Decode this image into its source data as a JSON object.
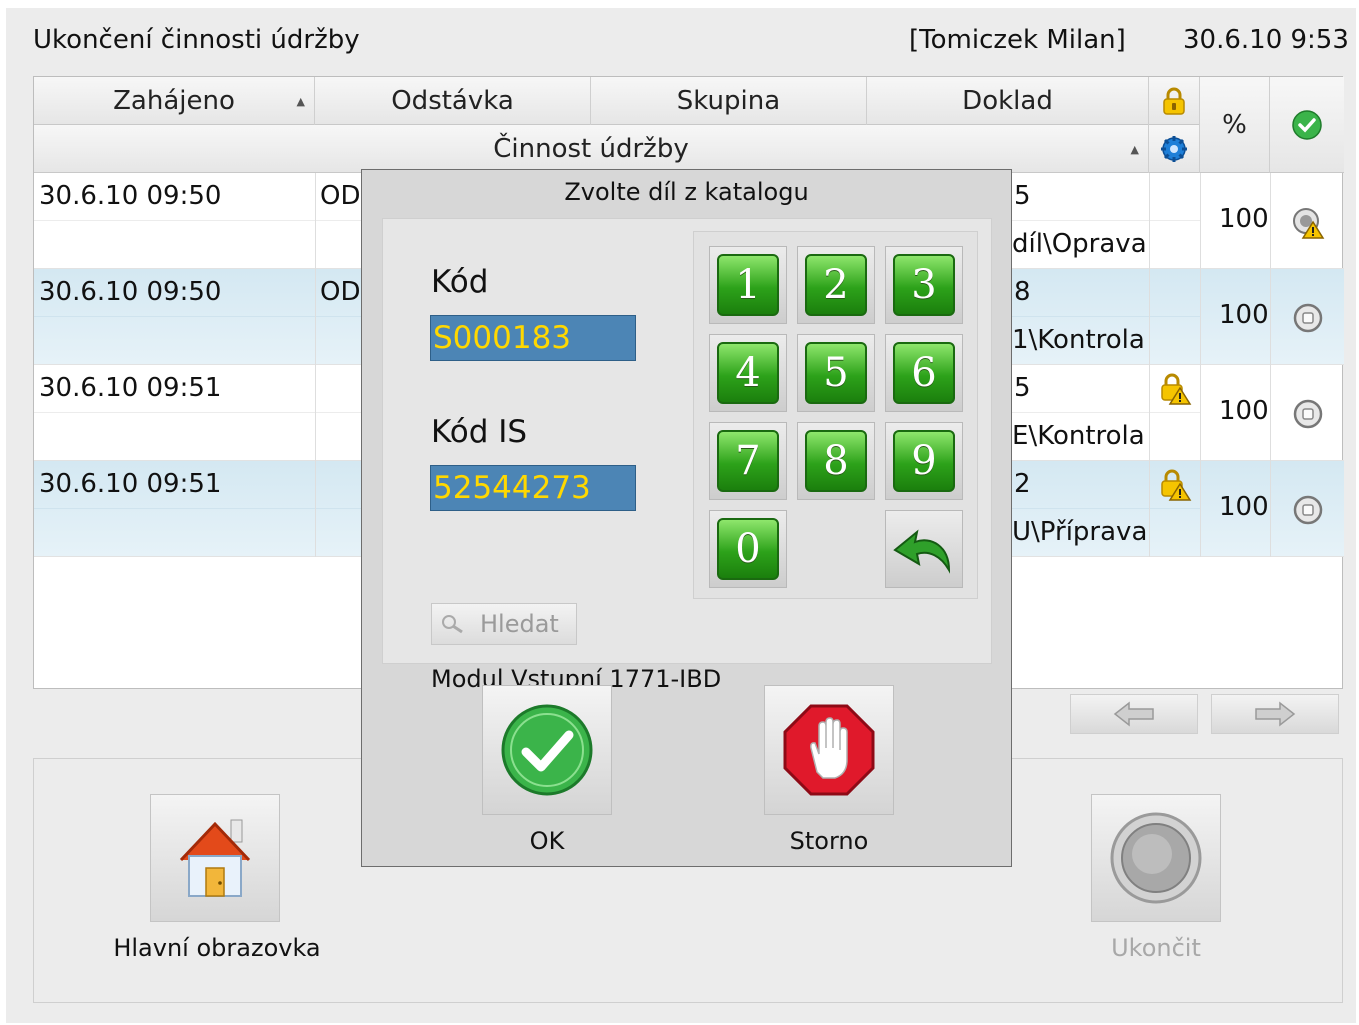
{
  "header": {
    "title": "Ukončení činnosti údržby",
    "user": "[Tomiczek Milan]",
    "datetime": "30.6.10 9:53"
  },
  "grid": {
    "columns": {
      "zahajeno": "Zahájeno",
      "odstavka": "Odstávka",
      "skupina": "Skupina",
      "doklad": "Doklad",
      "percent": "%",
      "cinnost": "Činnost údržby"
    },
    "rows": [
      {
        "date": "30.6.10 09:50",
        "odstavka": "OD",
        "doklad": "5",
        "activity": "díl\\Oprava",
        "percent": "100",
        "status_icon": "warning-status-icon",
        "lock": false
      },
      {
        "date": "30.6.10 09:50",
        "odstavka": "OD",
        "doklad": "8",
        "activity": "1\\Kontrola",
        "percent": "100",
        "status_icon": "stop-status-icon",
        "lock": false
      },
      {
        "date": "30.6.10 09:51",
        "odstavka": "",
        "doklad": "5",
        "activity": "E\\Kontrola",
        "percent": "100",
        "status_icon": "stop-status-icon",
        "lock": true
      },
      {
        "date": "30.6.10 09:51",
        "odstavka": "",
        "doklad": "2",
        "activity": "U\\Příprava",
        "percent": "100",
        "status_icon": "stop-status-icon",
        "lock": true
      }
    ]
  },
  "dialog": {
    "title": "Zvolte díl z katalogu",
    "kod_label": "Kód",
    "kod_value": "S000183",
    "kodis_label": "Kód IS",
    "kodis_value": "52544273",
    "search_label": "Hledat",
    "description": "Modul Vstupní 1771-IBD",
    "keys": [
      "1",
      "2",
      "3",
      "4",
      "5",
      "6",
      "7",
      "8",
      "9",
      "0"
    ],
    "ok_label": "OK",
    "storno_label": "Storno"
  },
  "bottom": {
    "home_label": "Hlavní obrazovka",
    "finish_label": "Ukončit"
  },
  "colors": {
    "selected_row": "#d9ebf4",
    "field_bg": "#4c85b5",
    "field_text": "#ffd800",
    "key_green": "#2da21a"
  }
}
